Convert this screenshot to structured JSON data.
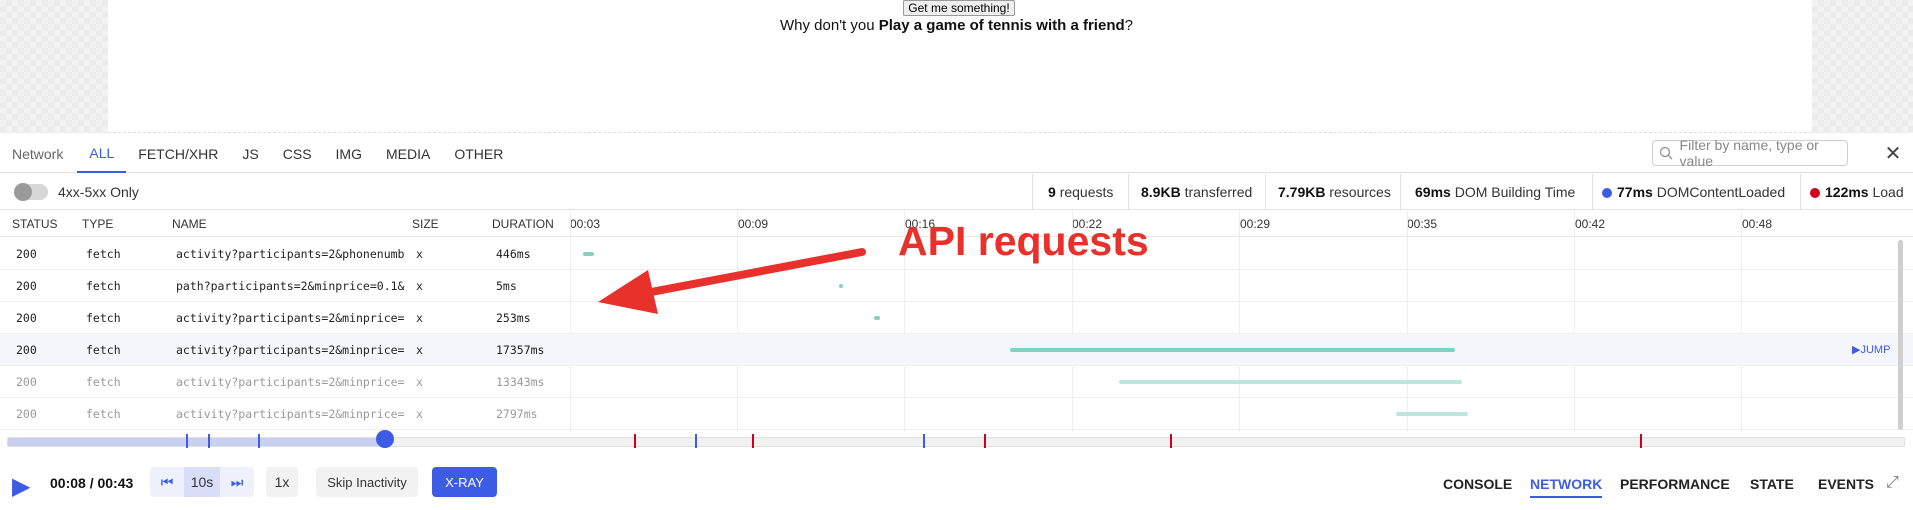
{
  "preview": {
    "button_label": "Get me something!",
    "prefix": "Why don't you ",
    "activity": "Play a game of tennis with a friend",
    "suffix": "?"
  },
  "tabs": {
    "title": "Network",
    "items": [
      "ALL",
      "FETCH/XHR",
      "JS",
      "CSS",
      "IMG",
      "MEDIA",
      "OTHER"
    ],
    "active": "ALL",
    "filter_placeholder": "Filter by name, type or value"
  },
  "stats": {
    "toggle_label": "4xx-5xx Only",
    "requests_value": "9",
    "requests_label": "requests",
    "transferred_value": "8.9KB",
    "transferred_label": "transferred",
    "resources_value": "7.79KB",
    "resources_label": "resources",
    "dom_build_value": "69ms",
    "dom_build_label": "DOM Building Time",
    "dcl_value": "77ms",
    "dcl_label": "DOMContentLoaded",
    "load_value": "122ms",
    "load_label": "Load",
    "dcl_color": "#3d5ce6",
    "load_color": "#d0021b"
  },
  "table": {
    "columns": [
      "STATUS",
      "TYPE",
      "NAME",
      "SIZE",
      "DURATION"
    ],
    "ticks": [
      "00:03",
      "00:09",
      "00:16",
      "00:22",
      "00:29",
      "00:35",
      "00:42",
      "00:48"
    ],
    "jump_label": "JUMP",
    "rows": [
      {
        "status": "200",
        "type": "fetch",
        "name": "activity?participants=2&phonenumb",
        "size": "x",
        "duration": "446ms"
      },
      {
        "status": "200",
        "type": "fetch",
        "name": "path?participants=2&minprice=0.1&",
        "size": "x",
        "duration": "5ms"
      },
      {
        "status": "200",
        "type": "fetch",
        "name": "activity?participants=2&minprice=",
        "size": "x",
        "duration": "253ms"
      },
      {
        "status": "200",
        "type": "fetch",
        "name": "activity?participants=2&minprice=",
        "size": "x",
        "duration": "17357ms"
      },
      {
        "status": "200",
        "type": "fetch",
        "name": "activity?participants=2&minprice=",
        "size": "x",
        "duration": "13343ms"
      },
      {
        "status": "200",
        "type": "fetch",
        "name": "activity?participants=2&minprice=",
        "size": "x",
        "duration": "2797ms"
      }
    ]
  },
  "annotation": "API requests",
  "player": {
    "time": "00:08 / 00:43",
    "skip_interval": "10s",
    "speed": "1x",
    "skip_inactivity": "Skip Inactivity",
    "xray": "X-RAY",
    "progress": 0.186,
    "bottom_tabs": [
      "CONSOLE",
      "NETWORK",
      "PERFORMANCE",
      "STATE",
      "EVENTS"
    ],
    "active_tab": "NETWORK"
  },
  "colors": {
    "accent": "#3d5ce6",
    "annotation": "#e8312b",
    "bar": "#86d0c0"
  }
}
